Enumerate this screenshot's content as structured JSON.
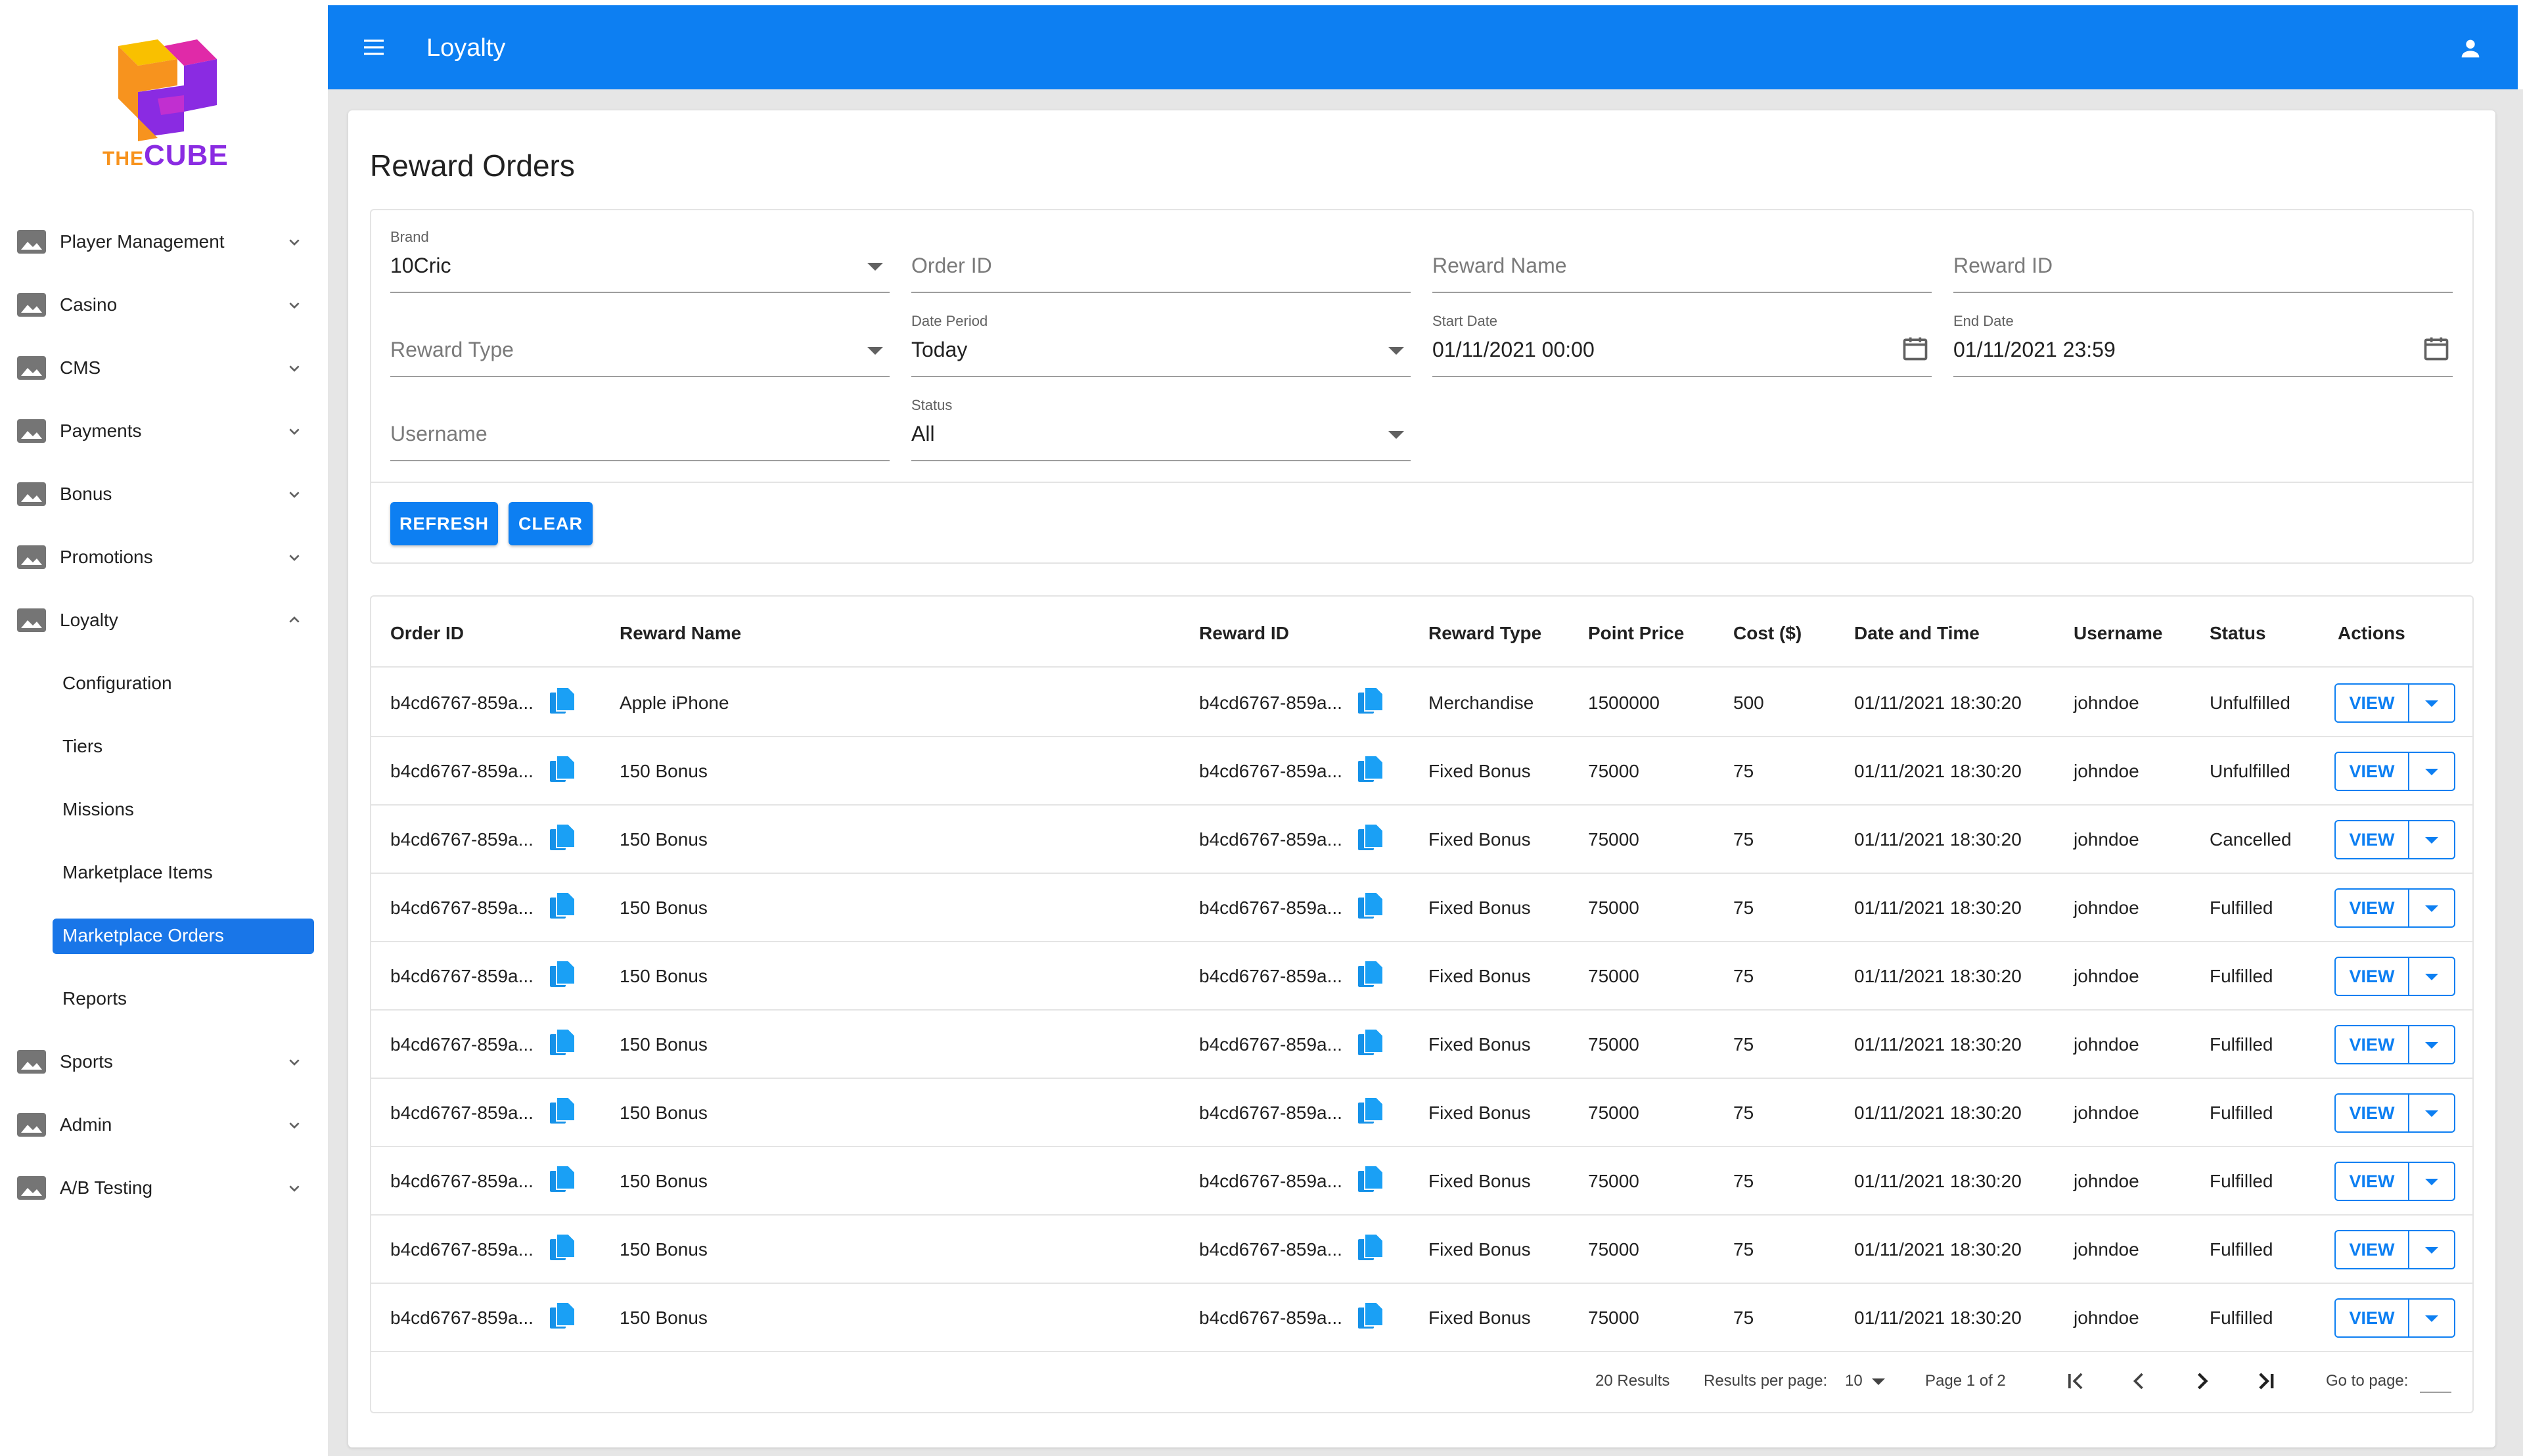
{
  "brand_logo": {
    "the": "THE",
    "cube": "CUBE",
    "colors": {
      "orange": "#f7931e",
      "purple": "#8a2be2",
      "yellow": "#f9c000",
      "magenta": "#e02aa8"
    }
  },
  "topbar": {
    "title": "Loyalty",
    "menu_icon": "menu-icon",
    "account_icon": "account-icon",
    "color": "#0d7ff2"
  },
  "sidebar": {
    "items": [
      {
        "label": "Player Management",
        "expanded": false
      },
      {
        "label": "Casino",
        "expanded": false
      },
      {
        "label": "CMS",
        "expanded": false
      },
      {
        "label": "Payments",
        "expanded": false
      },
      {
        "label": "Bonus",
        "expanded": false
      },
      {
        "label": "Promotions",
        "expanded": false
      },
      {
        "label": "Loyalty",
        "expanded": true
      }
    ],
    "loyalty_sub": [
      {
        "label": "Configuration"
      },
      {
        "label": "Tiers"
      },
      {
        "label": "Missions"
      },
      {
        "label": "Marketplace Items"
      },
      {
        "label": "Marketplace Orders",
        "active": true
      },
      {
        "label": "Reports"
      }
    ],
    "items_after": [
      {
        "label": "Sports"
      },
      {
        "label": "Admin"
      },
      {
        "label": "A/B Testing"
      }
    ]
  },
  "page": {
    "title": "Reward Orders"
  },
  "filters": {
    "brand": {
      "label": "Brand",
      "value": "10Cric"
    },
    "order_id": {
      "placeholder": "Order ID"
    },
    "reward_name": {
      "placeholder": "Reward Name"
    },
    "reward_id": {
      "placeholder": "Reward ID"
    },
    "reward_type": {
      "placeholder": "Reward Type"
    },
    "date_period": {
      "label": "Date Period",
      "value": "Today"
    },
    "start_date": {
      "label": "Start Date",
      "value": "01/11/2021 00:00"
    },
    "end_date": {
      "label": "End Date",
      "value": "01/11/2021 23:59"
    },
    "username": {
      "placeholder": "Username"
    },
    "status": {
      "label": "Status",
      "value": "All"
    },
    "refresh_label": "REFRESH",
    "clear_label": "CLEAR"
  },
  "table": {
    "columns": [
      "Order ID",
      "Reward Name",
      "Reward ID",
      "Reward Type",
      "Point Price",
      "Cost ($)",
      "Date and Time",
      "Username",
      "Status",
      "Actions"
    ],
    "view_label": "VIEW",
    "rows": [
      {
        "order_id": "b4cd6767-859a...",
        "reward_name": "Apple iPhone",
        "reward_id": "b4cd6767-859a...",
        "reward_type": "Merchandise",
        "point_price": "1500000",
        "cost": "500",
        "datetime": "01/11/2021 18:30:20",
        "username": "johndoe",
        "status": "Unfulfilled"
      },
      {
        "order_id": "b4cd6767-859a...",
        "reward_name": "150 Bonus",
        "reward_id": "b4cd6767-859a...",
        "reward_type": "Fixed Bonus",
        "point_price": "75000",
        "cost": "75",
        "datetime": "01/11/2021 18:30:20",
        "username": "johndoe",
        "status": "Unfulfilled"
      },
      {
        "order_id": "b4cd6767-859a...",
        "reward_name": "150 Bonus",
        "reward_id": "b4cd6767-859a...",
        "reward_type": "Fixed Bonus",
        "point_price": "75000",
        "cost": "75",
        "datetime": "01/11/2021 18:30:20",
        "username": "johndoe",
        "status": "Cancelled"
      },
      {
        "order_id": "b4cd6767-859a...",
        "reward_name": "150 Bonus",
        "reward_id": "b4cd6767-859a...",
        "reward_type": "Fixed Bonus",
        "point_price": "75000",
        "cost": "75",
        "datetime": "01/11/2021 18:30:20",
        "username": "johndoe",
        "status": "Fulfilled"
      },
      {
        "order_id": "b4cd6767-859a...",
        "reward_name": "150 Bonus",
        "reward_id": "b4cd6767-859a...",
        "reward_type": "Fixed Bonus",
        "point_price": "75000",
        "cost": "75",
        "datetime": "01/11/2021 18:30:20",
        "username": "johndoe",
        "status": "Fulfilled"
      },
      {
        "order_id": "b4cd6767-859a...",
        "reward_name": "150 Bonus",
        "reward_id": "b4cd6767-859a...",
        "reward_type": "Fixed Bonus",
        "point_price": "75000",
        "cost": "75",
        "datetime": "01/11/2021 18:30:20",
        "username": "johndoe",
        "status": "Fulfilled"
      },
      {
        "order_id": "b4cd6767-859a...",
        "reward_name": "150 Bonus",
        "reward_id": "b4cd6767-859a...",
        "reward_type": "Fixed Bonus",
        "point_price": "75000",
        "cost": "75",
        "datetime": "01/11/2021 18:30:20",
        "username": "johndoe",
        "status": "Fulfilled"
      },
      {
        "order_id": "b4cd6767-859a...",
        "reward_name": "150 Bonus",
        "reward_id": "b4cd6767-859a...",
        "reward_type": "Fixed Bonus",
        "point_price": "75000",
        "cost": "75",
        "datetime": "01/11/2021 18:30:20",
        "username": "johndoe",
        "status": "Fulfilled"
      },
      {
        "order_id": "b4cd6767-859a...",
        "reward_name": "150 Bonus",
        "reward_id": "b4cd6767-859a...",
        "reward_type": "Fixed Bonus",
        "point_price": "75000",
        "cost": "75",
        "datetime": "01/11/2021 18:30:20",
        "username": "johndoe",
        "status": "Fulfilled"
      },
      {
        "order_id": "b4cd6767-859a...",
        "reward_name": "150 Bonus",
        "reward_id": "b4cd6767-859a...",
        "reward_type": "Fixed Bonus",
        "point_price": "75000",
        "cost": "75",
        "datetime": "01/11/2021 18:30:20",
        "username": "johndoe",
        "status": "Fulfilled"
      }
    ]
  },
  "pagination": {
    "results": "20 Results",
    "per_page_label": "Results per page:",
    "per_page_value": "10",
    "page_info": "Page 1 of 2",
    "goto_label": "Go to page:"
  }
}
